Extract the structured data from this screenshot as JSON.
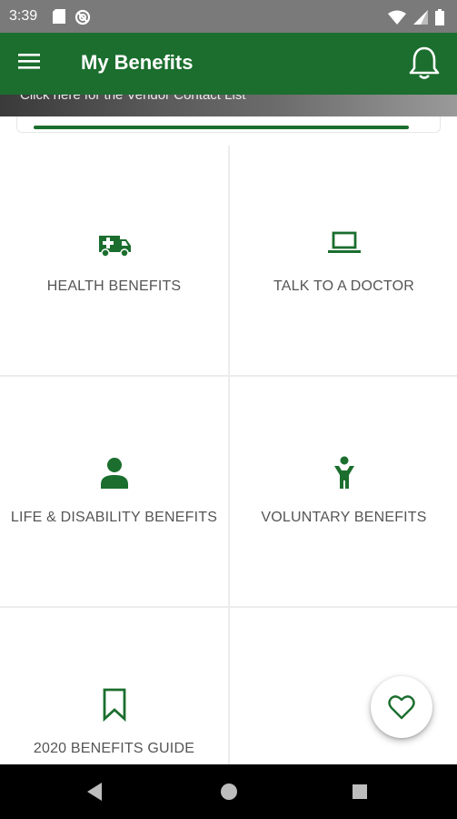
{
  "status_bar": {
    "time": "3:39",
    "left_icons": [
      "sd-card-icon",
      "do-not-disturb-icon"
    ],
    "right_icons": [
      "wifi-icon",
      "signal-icon",
      "battery-icon"
    ]
  },
  "app_bar": {
    "title": "My Benefits",
    "menu_icon": "menu-icon",
    "notification_icon": "bell-icon",
    "color": "#1b6e2e"
  },
  "banner": {
    "text": "Click here for the Vendor Contact List"
  },
  "carousel": {
    "progress": 0.96
  },
  "tiles": [
    {
      "label": "HEALTH BENEFITS",
      "icon": "ambulance-icon"
    },
    {
      "label": "TALK TO A DOCTOR",
      "icon": "laptop-icon"
    },
    {
      "label": "LIFE & DISABILITY BENEFITS",
      "icon": "person-icon"
    },
    {
      "label": "VOLUNTARY BENEFITS",
      "icon": "child-icon"
    },
    {
      "label": "2020 BENEFITS GUIDE",
      "icon": "bookmark-icon"
    }
  ],
  "fab": {
    "icon": "heart-icon"
  },
  "nav": {
    "icons": [
      "back-icon",
      "home-icon",
      "recents-icon"
    ]
  }
}
